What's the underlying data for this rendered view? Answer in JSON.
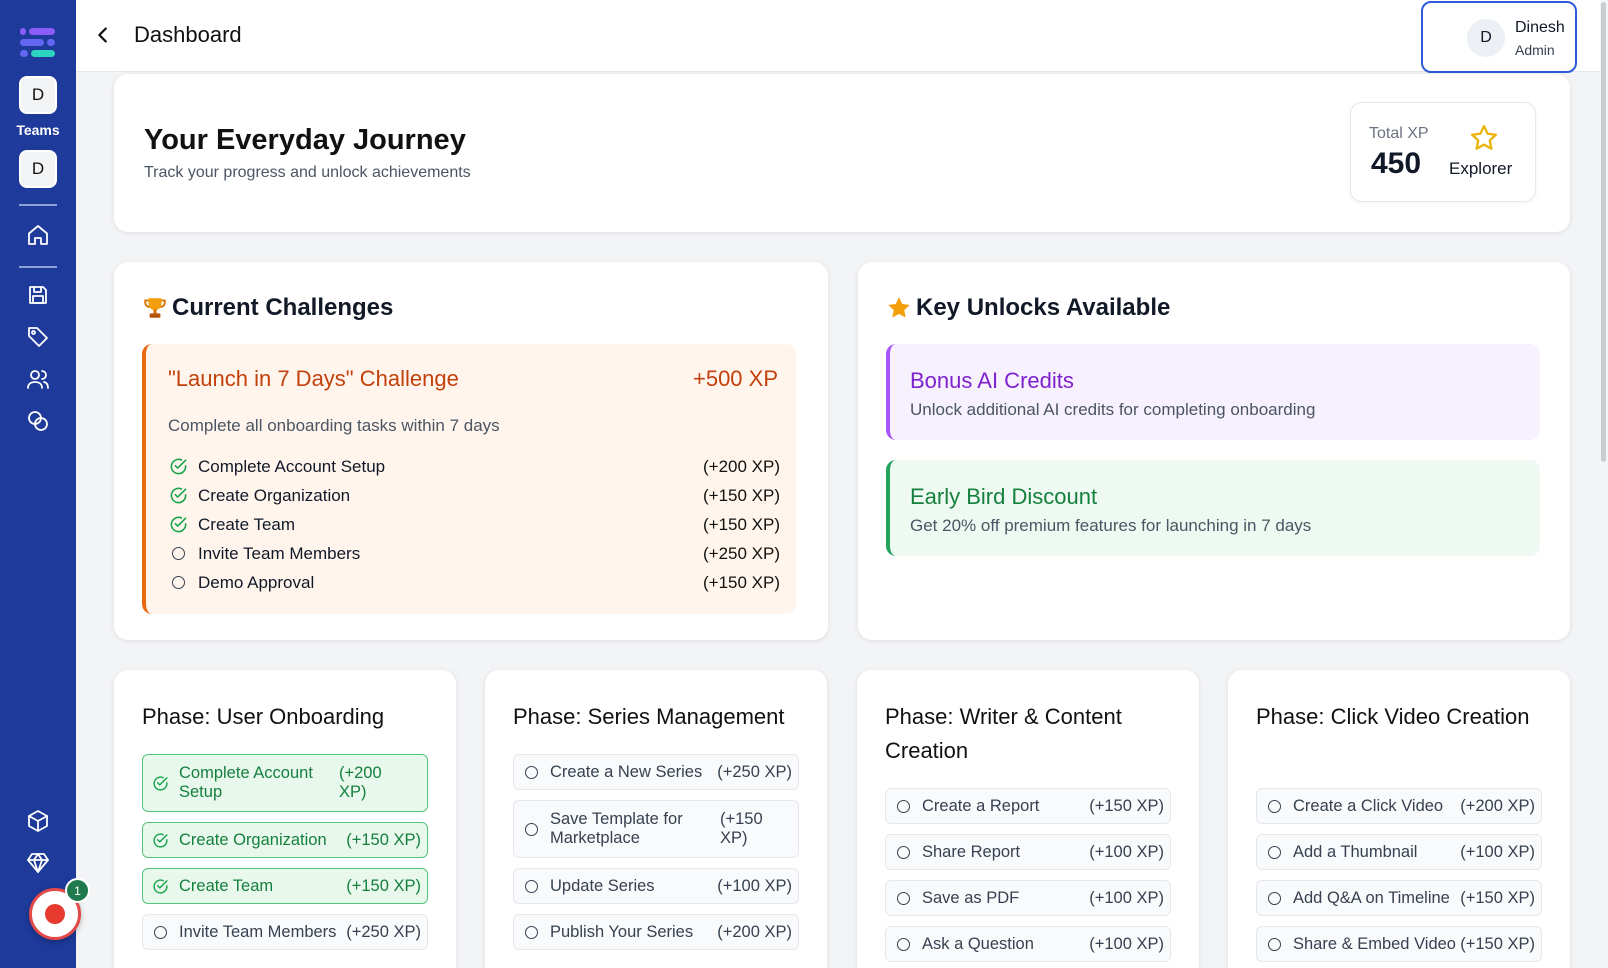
{
  "sidebar": {
    "teams_label": "Teams",
    "team_avatars": [
      "D",
      "D"
    ],
    "nav_icons": [
      "home-icon",
      "save-icon",
      "tag-icon",
      "users-icon",
      "coins-icon"
    ],
    "bottom_icons": [
      "package-icon",
      "diamond-icon",
      "document-icon"
    ],
    "record_badge": "1",
    "colors": {
      "background": "#1e3a9a"
    }
  },
  "header": {
    "title": "Dashboard",
    "user": {
      "initial": "D",
      "name": "Dinesh",
      "role": "Admin"
    }
  },
  "hero": {
    "title": "Your Everyday Journey",
    "subtitle": "Track your progress and unlock achievements",
    "xp_label": "Total XP",
    "xp_value": "450",
    "level": "Explorer"
  },
  "challenges": {
    "title": "Current Challenges",
    "challenge": {
      "title": "\"Launch in 7 Days\" Challenge",
      "xp": "+500 XP",
      "description": "Complete all onboarding tasks within 7 days",
      "tasks": [
        {
          "label": "Complete Account Setup",
          "points": "(+200 XP)",
          "done": true
        },
        {
          "label": "Create Organization",
          "points": "(+150 XP)",
          "done": true
        },
        {
          "label": "Create Team",
          "points": "(+150 XP)",
          "done": true
        },
        {
          "label": "Invite Team Members",
          "points": "(+250 XP)",
          "done": false
        },
        {
          "label": "Demo Approval",
          "points": "(+150 XP)",
          "done": false
        }
      ]
    }
  },
  "unlocks": {
    "title": "Key Unlocks Available",
    "items": [
      {
        "title": "Bonus AI Credits",
        "description": "Unlock additional AI credits for completing onboarding"
      },
      {
        "title": "Early Bird Discount",
        "description": "Get 20% off premium features for launching in 7 days"
      }
    ]
  },
  "phases": [
    {
      "title": "Phase: User Onboarding",
      "tasks": [
        {
          "label": "Complete Account Setup",
          "points": "(+200 XP)",
          "done": true
        },
        {
          "label": "Create Organization",
          "points": "(+150 XP)",
          "done": true
        },
        {
          "label": "Create Team",
          "points": "(+150 XP)",
          "done": true
        },
        {
          "label": "Invite Team Members",
          "points": "(+250 XP)",
          "done": false
        }
      ]
    },
    {
      "title": "Phase: Series Management",
      "tasks": [
        {
          "label": "Create a New Series",
          "points": "(+250 XP)",
          "done": false
        },
        {
          "label": "Save Template for Marketplace",
          "points": "(+150 XP)",
          "done": false
        },
        {
          "label": "Update Series",
          "points": "(+100 XP)",
          "done": false
        },
        {
          "label": "Publish Your Series",
          "points": "(+200 XP)",
          "done": false
        }
      ]
    },
    {
      "title": "Phase: Writer & Content Creation",
      "tasks": [
        {
          "label": "Create a Report",
          "points": "(+150 XP)",
          "done": false
        },
        {
          "label": "Share Report",
          "points": "(+100 XP)",
          "done": false
        },
        {
          "label": "Save as PDF",
          "points": "(+100 XP)",
          "done": false
        },
        {
          "label": "Ask a Question",
          "points": "(+100 XP)",
          "done": false
        }
      ]
    },
    {
      "title": "Phase: Click Video Creation",
      "tasks": [
        {
          "label": "Create a Click Video",
          "points": "(+200 XP)",
          "done": false
        },
        {
          "label": "Add a Thumbnail",
          "points": "(+100 XP)",
          "done": false
        },
        {
          "label": "Add Q&A on Timeline",
          "points": "(+150 XP)",
          "done": false
        },
        {
          "label": "Share & Embed Video",
          "points": "(+150 XP)",
          "done": false
        }
      ]
    }
  ]
}
